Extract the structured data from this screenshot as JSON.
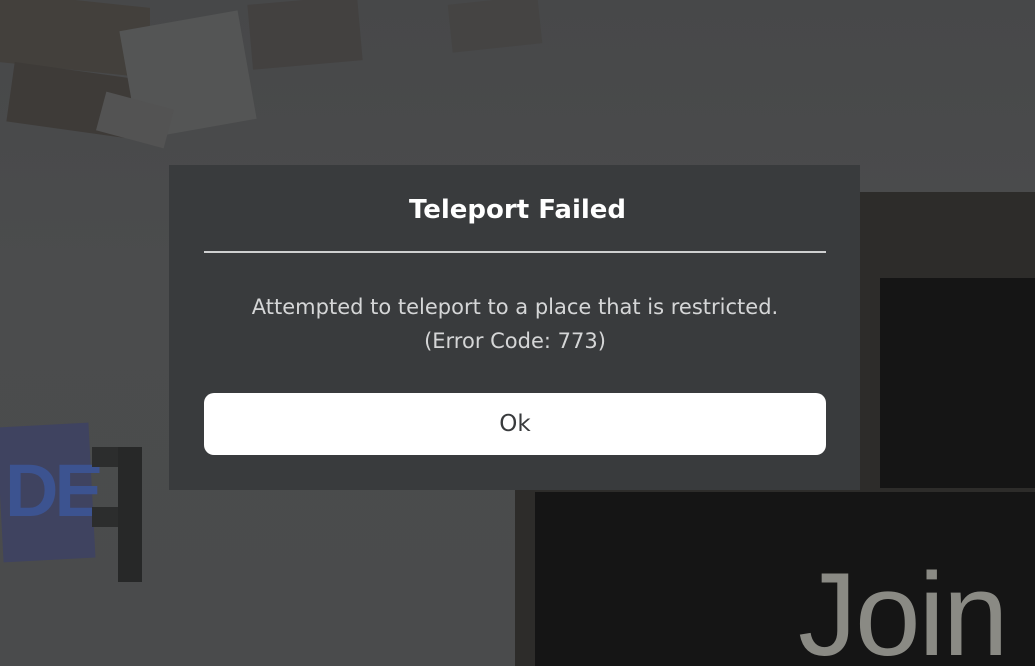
{
  "dialog": {
    "title": "Teleport Failed",
    "message_line1": "Attempted to teleport to a place that is restricted.",
    "message_line2": "(Error Code: 773)",
    "ok_label": "Ok"
  },
  "scene": {
    "sign_text": "DE",
    "billboard_text": "Join"
  },
  "colors": {
    "dialog_background": "#393b3d",
    "dialog_title": "#ffffff",
    "dialog_message": "#d5d6d7",
    "button_background": "#ffffff",
    "button_text": "#393b3d"
  }
}
